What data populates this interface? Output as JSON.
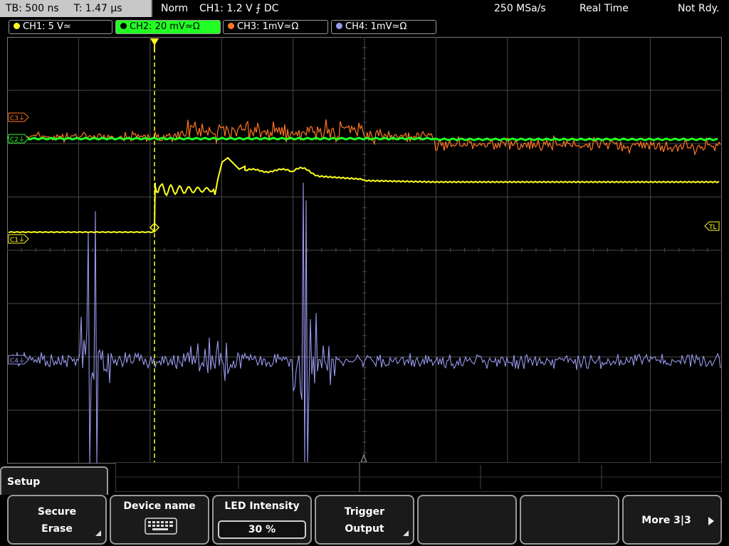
{
  "status": {
    "timebase": "TB: 500 ns",
    "trigger_time": "T: 1.47 µs",
    "acq_mode": "Norm",
    "trigger_info": "CH1: 1.2 V ⨍ DC",
    "sample_rate": "250 MSa/s",
    "time_mode": "Real Time",
    "ready_state": "Not Rdy."
  },
  "channels": [
    {
      "label": "CH1: 5 V≃",
      "color": "#ffff22",
      "active": false
    },
    {
      "label": "CH2: 20 mV≃Ω",
      "color": "#22ff22",
      "active": true
    },
    {
      "label": "CH3: 1mV≃Ω",
      "color": "#ff7722",
      "active": false
    },
    {
      "label": "CH4: 1mV≃Ω",
      "color": "#9999ee",
      "active": false
    }
  ],
  "markers": {
    "c3": "C3⏚",
    "c2": "C2⏚",
    "c1": "C1⏚",
    "c4": "C4⏚",
    "trigger_level": "TL"
  },
  "menu": {
    "title": "Setup",
    "buttons": [
      {
        "line1": "Secure",
        "line2": "Erase"
      },
      {
        "line1": "Device name",
        "icon": "keyboard-icon"
      },
      {
        "line1": "LED Intensity",
        "value": "30 %"
      },
      {
        "line1": "Trigger",
        "line2": "Output"
      },
      {
        "line1": ""
      },
      {
        "line1": ""
      },
      {
        "line1": "More 3|3"
      }
    ]
  },
  "colors": {
    "ch1": "#ffff22",
    "ch2": "#22ff22",
    "ch3": "#ff7722",
    "ch4": "#9999ee",
    "grid": "#4a4a4a"
  }
}
